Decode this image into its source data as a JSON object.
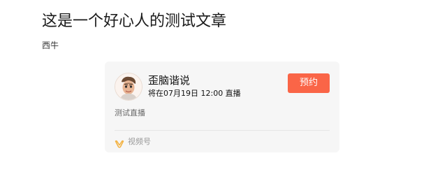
{
  "article": {
    "title": "这是一个好心人的测试文章",
    "author": "西牛"
  },
  "live_card": {
    "channel_name": "歪脑谐说",
    "schedule": "将在07月19日 12:00 直播",
    "reserve_label": "预约",
    "description": "测试直播",
    "footer_label": "视频号",
    "footer_icon": "channels-icon",
    "avatar_icon": "avatar",
    "colors": {
      "reserve_button": "#fa6547",
      "footer_icon": "#f3b13f",
      "card_background": "#f6f6f6"
    }
  }
}
